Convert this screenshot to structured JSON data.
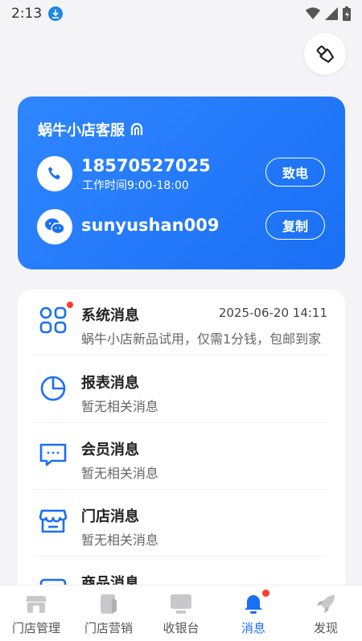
{
  "status_bar": {
    "time": "2:13"
  },
  "service": {
    "title": "蜗牛小店客服",
    "phone": "18570527025",
    "work_hours": "工作时间9:00-18:00",
    "call_label": "致电",
    "wechat": "sunyushan009",
    "copy_label": "复制"
  },
  "messages": [
    {
      "title": "系统消息",
      "subtitle": "蜗牛小店新品试用，仅需1分钱，包邮到家",
      "time": "2025-06-20 14:11",
      "unread": true
    },
    {
      "title": "报表消息",
      "subtitle": "暂无相关消息",
      "time": "",
      "unread": false
    },
    {
      "title": "会员消息",
      "subtitle": "暂无相关消息",
      "time": "",
      "unread": false
    },
    {
      "title": "门店消息",
      "subtitle": "暂无相关消息",
      "time": "",
      "unread": false
    },
    {
      "title": "商品消息",
      "subtitle": "",
      "time": "",
      "unread": false
    }
  ],
  "tabs": [
    {
      "label": "门店管理",
      "active": false
    },
    {
      "label": "门店营销",
      "active": false
    },
    {
      "label": "收银台",
      "active": false
    },
    {
      "label": "消息",
      "active": true
    },
    {
      "label": "发现",
      "active": false
    }
  ],
  "colors": {
    "accent": "#1a6ff5",
    "badge": "#ff3b30",
    "inactive_icon": "#c8c8cc"
  }
}
